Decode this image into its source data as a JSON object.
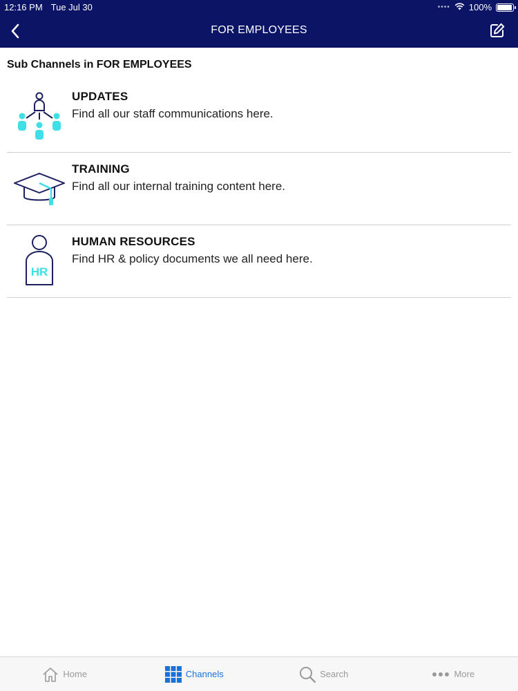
{
  "status_bar": {
    "time": "12:16 PM",
    "date": "Tue Jul 30",
    "battery": "100%",
    "battery_level": 1.0
  },
  "nav": {
    "title": "FOR EMPLOYEES",
    "back_icon": "chevron-left-icon",
    "compose_icon": "compose-icon"
  },
  "section": {
    "title": "Sub Channels in FOR EMPLOYEES"
  },
  "channels": [
    {
      "name": "UPDATES",
      "description": "Find all our staff communications here.",
      "icon": "people-network-icon"
    },
    {
      "name": "TRAINING",
      "description": "Find all our internal training content here.",
      "icon": "graduation-cap-icon"
    },
    {
      "name": "HUMAN RESOURCES",
      "description": "Find HR & policy documents we all need here.",
      "icon": "hr-person-icon",
      "icon_text": "HR"
    }
  ],
  "tabs": [
    {
      "label": "Home",
      "icon": "home-icon",
      "active": false
    },
    {
      "label": "Channels",
      "icon": "grid-icon",
      "active": true
    },
    {
      "label": "Search",
      "icon": "search-icon",
      "active": false
    },
    {
      "label": "More",
      "icon": "more-icon",
      "active": false
    }
  ],
  "colors": {
    "header_bg": "#0c1466",
    "accent": "#1a72d8",
    "icon_cyan": "#3ee0e6",
    "icon_navy": "#1b1f5e"
  }
}
